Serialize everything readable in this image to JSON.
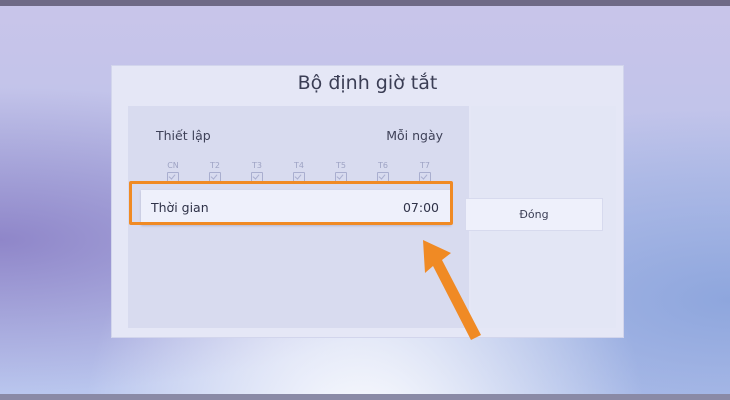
{
  "dialog": {
    "title": "Bộ định giờ tắt",
    "setting": {
      "label": "Thiết lập",
      "value": "Mỗi ngày"
    },
    "days": [
      "CN",
      "T2",
      "T3",
      "T4",
      "T5",
      "T6",
      "T7"
    ],
    "time": {
      "label": "Thời gian",
      "value": "07:00"
    },
    "close_label": "Đóng"
  },
  "colors": {
    "highlight": "#f08a24",
    "panel": "#d8dbef",
    "dialog": "#e5e7f6"
  }
}
